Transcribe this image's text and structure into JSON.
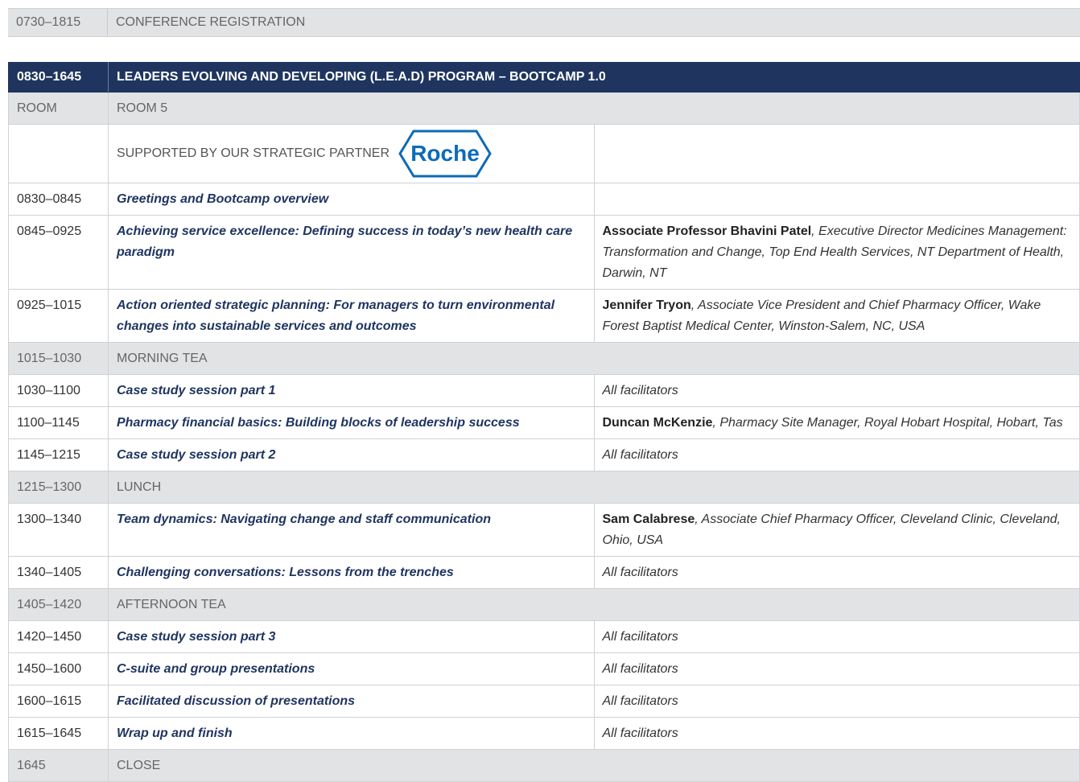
{
  "registration": {
    "time": "0730–1815",
    "label": "CONFERENCE REGISTRATION"
  },
  "program": {
    "header_time": "0830–1645",
    "header_title": "LEADERS EVOLVING AND DEVELOPING (L.E.A.D) PROGRAM – BOOTCAMP 1.0",
    "room_label": "ROOM",
    "room_value": "ROOM 5",
    "sponsor_text": "SUPPORTED BY OUR STRATEGIC PARTNER",
    "sponsor_logo": "Roche",
    "sponsor_color": "#0b6bb8"
  },
  "sessions": [
    {
      "time": "0830–0845",
      "title": "Greetings and Bootcamp overview",
      "speaker_name": "",
      "speaker_role": "",
      "facilitators": ""
    },
    {
      "time": "0845–0925",
      "title": "Achieving service excellence: Defining success in today’s new health care paradigm",
      "speaker_name": "Associate Professor Bhavini Patel",
      "speaker_role": ", Executive Director Medicines Management: Transformation and Change, Top End Health Services, NT Department of Health, Darwin, NT",
      "facilitators": ""
    },
    {
      "time": "0925–1015",
      "title": "Action oriented strategic planning: For managers to turn environmental changes into sustainable services and outcomes",
      "speaker_name": "Jennifer Tryon",
      "speaker_role": ", Associate Vice President and Chief Pharmacy Officer, Wake Forest Baptist Medical Center, Winston-Salem, NC, USA",
      "facilitators": ""
    },
    {
      "time": "1015–1030",
      "break": "MORNING TEA"
    },
    {
      "time": "1030–1100",
      "title": "Case study session part 1",
      "speaker_name": "",
      "speaker_role": "",
      "facilitators": "All facilitators"
    },
    {
      "time": "1100–1145",
      "title": "Pharmacy financial basics: Building blocks of leadership success",
      "speaker_name": "Duncan McKenzie",
      "speaker_role": ", Pharmacy Site Manager, Royal Hobart Hospital, Hobart, Tas",
      "facilitators": ""
    },
    {
      "time": "1145–1215",
      "title": "Case study session part 2",
      "speaker_name": "",
      "speaker_role": "",
      "facilitators": "All facilitators"
    },
    {
      "time": "1215–1300",
      "break": "LUNCH"
    },
    {
      "time": "1300–1340",
      "title": "Team dynamics: Navigating change and staff communication",
      "speaker_name": "Sam Calabrese",
      "speaker_role": ", Associate Chief Pharmacy Officer, Cleveland Clinic, Cleveland, Ohio, USA",
      "facilitators": ""
    },
    {
      "time": "1340–1405",
      "title": "Challenging conversations: Lessons from the trenches",
      "speaker_name": "",
      "speaker_role": "",
      "facilitators": "All facilitators"
    },
    {
      "time": "1405–1420",
      "break": "AFTERNOON TEA"
    },
    {
      "time": "1420–1450",
      "title": "Case study session part 3",
      "speaker_name": "",
      "speaker_role": "",
      "facilitators": "All facilitators"
    },
    {
      "time": "1450–1600",
      "title": "C-suite and group presentations",
      "speaker_name": "",
      "speaker_role": "",
      "facilitators": "All facilitators"
    },
    {
      "time": "1600–1615",
      "title": "Facilitated discussion of presentations",
      "speaker_name": "",
      "speaker_role": "",
      "facilitators": "All facilitators"
    },
    {
      "time": "1615–1645",
      "title": "Wrap up and finish",
      "speaker_name": "",
      "speaker_role": "",
      "facilitators": "All facilitators"
    },
    {
      "time": "1645",
      "break": "CLOSE"
    }
  ]
}
